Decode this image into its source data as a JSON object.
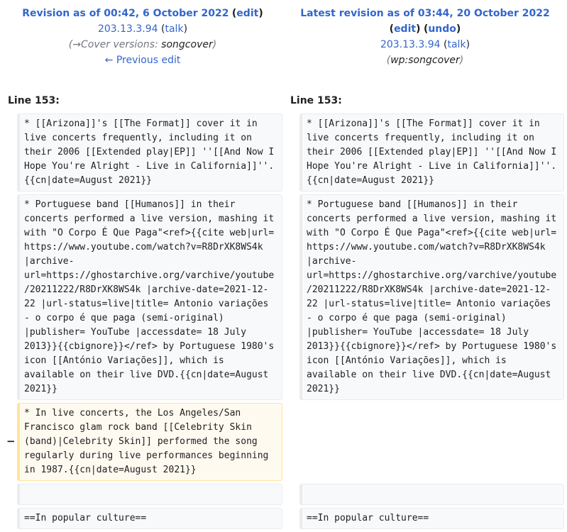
{
  "left_header": {
    "title_prefix": "Revision as of 00:42, 6 October 2022",
    "edit_label": "edit",
    "user": "203.13.3.94",
    "talk_label": "talk",
    "summary_arrow": "→",
    "summary_section": "Cover versions:",
    "summary_text": " songcover",
    "prev_link": "← Previous edit"
  },
  "right_header": {
    "title_prefix": "Latest revision as of 03:44, 20 October 2022",
    "edit_label": "edit",
    "undo_label": "undo",
    "user": "203.13.3.94",
    "talk_label": "talk",
    "summary": "wp:songcover"
  },
  "line_numbers": {
    "left": "Line 153:",
    "right": "Line 153:"
  },
  "diff": {
    "marker_minus": "−",
    "left": {
      "block1": "* [[Arizona]]'s [[The Format]] cover it in live concerts frequently, including it on their 2006 [[Extended play|EP]] ''[[And Now I Hope You're Alright - Live in California]]''.{{cn|date=August 2021}}",
      "block2": "* Portuguese band [[Humanos]] in their concerts performed a live version, mashing it with \"O Corpo É Que Paga\"<ref>{{cite web|url= https://www.youtube.com/watch?v=R8DrXK8WS4k  |archive-url=https://ghostarchive.org/varchive/youtube/20211222/R8DrXK8WS4k |archive-date=2021-12-22 |url-status=live|title= Antonio variações - o corpo é que paga (semi-original) |publisher= YouTube |accessdate= 18 July 2013}}{{cbignore}}</ref> by Portuguese 1980's icon [[António Variações]], which is available on their live DVD.{{cn|date=August 2021}}",
      "block3_deleted": "* In live concerts, the Los Angeles/San Francisco glam rock band [[Celebrity Skin (band)|Celebrity Skin]] performed the song regularly during live performances beginning in 1987.{{cn|date=August 2021}}",
      "block4": "",
      "block5": "==In popular culture=="
    },
    "right": {
      "block1": "* [[Arizona]]'s [[The Format]] cover it in live concerts frequently, including it on their 2006 [[Extended play|EP]] ''[[And Now I Hope You're Alright - Live in California]]''.{{cn|date=August 2021}}",
      "block2": "* Portuguese band [[Humanos]] in their concerts performed a live version, mashing it with \"O Corpo É Que Paga\"<ref>{{cite web|url= https://www.youtube.com/watch?v=R8DrXK8WS4k  |archive-url=https://ghostarchive.org/varchive/youtube/20211222/R8DrXK8WS4k |archive-date=2021-12-22 |url-status=live|title= Antonio variações - o corpo é que paga (semi-original) |publisher= YouTube |accessdate= 18 July 2013}}{{cbignore}}</ref> by Portuguese 1980's icon [[António Variações]], which is available on their live DVD.{{cn|date=August 2021}}",
      "block4": "",
      "block5": "==In popular culture=="
    }
  }
}
